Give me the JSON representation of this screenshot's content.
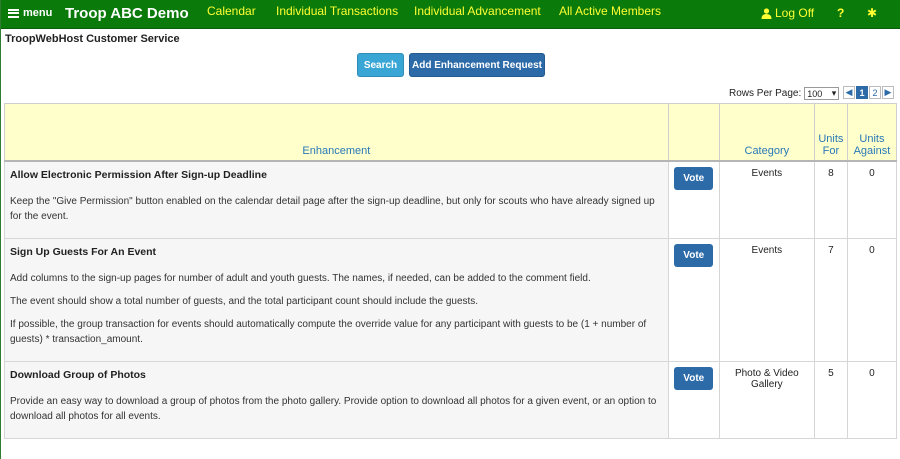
{
  "topbar": {
    "menu_label": "menu",
    "title": "Troop ABC Demo",
    "nav": [
      "Calendar",
      "Individual Transactions",
      "Individual Advancement",
      "All Active Members"
    ],
    "logoff_label": "Log Off",
    "help_label": "?",
    "settings_glyph": "✱"
  },
  "service_title": "TroopWebHost Customer Service",
  "buttons": {
    "search": "Search",
    "add": "Add Enhancement Request"
  },
  "pagination": {
    "rows_label": "Rows Per Page:",
    "rows_value": "100",
    "prev": "◀",
    "pages": [
      "1",
      "2"
    ],
    "next": "▶"
  },
  "table": {
    "headers": {
      "enhancement": "Enhancement",
      "vote": "",
      "category": "Category",
      "units_for": "Units For",
      "units_against": "Units Against"
    },
    "rows": [
      {
        "title": "Allow Electronic Permission After Sign-up Deadline",
        "paragraphs": [
          "Keep the \"Give Permission\" button enabled on the calendar detail page after the sign-up deadline, but only for scouts who have already signed up for the event."
        ],
        "vote": "Vote",
        "category": "Events",
        "units_for": "8",
        "units_against": "0"
      },
      {
        "title": "Sign Up Guests For An Event",
        "paragraphs": [
          "Add columns to the sign-up pages for number of adult and youth guests.  The names, if needed, can be added to the comment field.",
          "The event should show a total number of guests, and the total participant count should include the guests.",
          "If possible, the group transaction for events should automatically compute the override value for any participant with guests to be (1 + number of guests) * transaction_amount."
        ],
        "vote": "Vote",
        "category": "Events",
        "units_for": "7",
        "units_against": "0"
      },
      {
        "title": "Download Group of Photos",
        "paragraphs": [
          "Provide an easy way to download a group of photos from the photo gallery.  Provide option to download all photos for a given event, or an option to download all photos for all events."
        ],
        "vote": "Vote",
        "category": "Photo & Video Gallery",
        "units_for": "5",
        "units_against": "0"
      }
    ]
  }
}
